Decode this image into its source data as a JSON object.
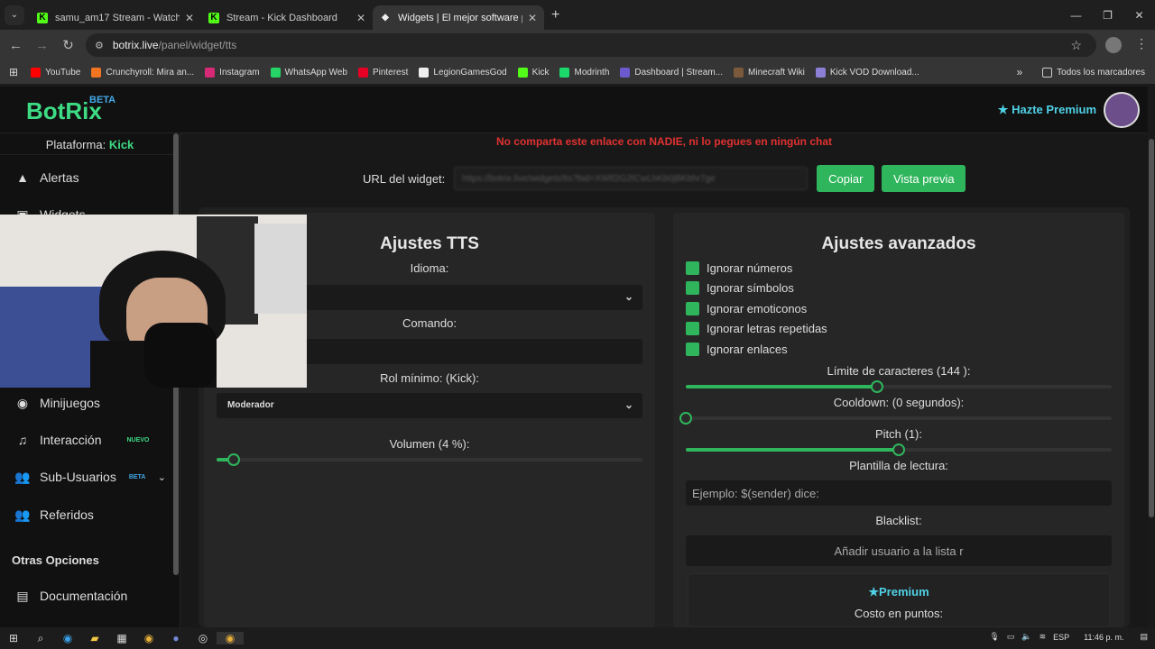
{
  "browser": {
    "tabs": [
      {
        "title": "samu_am17 Stream - Watch Live",
        "active": false,
        "icon": "kick-icon"
      },
      {
        "title": "Stream - Kick Dashboard",
        "active": false,
        "icon": "kick-icon"
      },
      {
        "title": "Widgets | El mejor software para",
        "active": true,
        "icon": "botrix-icon"
      }
    ],
    "url_host": "botrix.live",
    "url_path": "/panel/widget/tts",
    "bookmarks": [
      "YouTube",
      "Crunchyroll: Mira an...",
      "Instagram",
      "WhatsApp Web",
      "Pinterest",
      "LegionGamesGod",
      "Kick",
      "Modrinth",
      "Dashboard | Stream...",
      "Minecraft Wiki",
      "Kick VOD Download..."
    ],
    "bookmark_colors": [
      "#ff0000",
      "#f47521",
      "#d62976",
      "#25d366",
      "#e60023",
      "#eeeeee",
      "#53fc18",
      "#1bd96a",
      "#6a5acd",
      "#7a5a3a",
      "#8b7fd6"
    ],
    "all_bookmarks": "Todos los marcadores"
  },
  "header": {
    "logo": "BotRix",
    "logo_badge": "BETA",
    "premium_link": "Hazte Premium"
  },
  "sidebar": {
    "platform_label": "Plataforma:",
    "platform_value": "Kick",
    "items": [
      {
        "label": "Alertas"
      },
      {
        "label": "Widgets"
      },
      {
        "label": "Minijuegos"
      },
      {
        "label": "Interacción",
        "badge": "NUEVO"
      },
      {
        "label": "Sub-Usuarios",
        "badge": "BETA"
      },
      {
        "label": "Referidos"
      }
    ],
    "section": "Otras Opciones",
    "doc_label": "Documentación"
  },
  "widget": {
    "warning": "No comparta este enlace con NADIE, ni lo pegues en ningún chat",
    "url_label": "URL del widget:",
    "url_value": "https://botrix.live/widgets/tts?bid=XWtf2G2tCwLhKb0jBKbhr7ge",
    "copy_button": "Copiar",
    "preview_button": "Vista previa"
  },
  "tts": {
    "title": "Ajustes TTS",
    "language_label": "Idioma:",
    "command_label": "Comando:",
    "role_label": "Rol mínimo: (Kick):",
    "role_value": "Moderador",
    "volume_label": "Volumen (4 %):",
    "volume": 4
  },
  "advanced": {
    "title": "Ajustes avanzados",
    "checkboxes": [
      "Ignorar números",
      "Ignorar símbolos",
      "Ignorar emoticonos",
      "Ignorar letras repetidas",
      "Ignorar enlaces"
    ],
    "char_limit_label": "Límite de caracteres (144 ):",
    "char_limit": 144,
    "char_limit_fraction": 0.45,
    "cooldown_label": "Cooldown: (0 segundos):",
    "cooldown_fraction": 0,
    "pitch_label": "Pitch (1):",
    "pitch_fraction": 0.5,
    "template_label": "Plantilla de lectura:",
    "template_placeholder": "Ejemplo: $(sender) dice:",
    "blacklist_label": "Blacklist:",
    "blacklist_placeholder": "Añadir usuario a la lista r",
    "premium_title": "Premium",
    "cost_label": "Costo en puntos:"
  },
  "taskbar": {
    "lang": "ESP",
    "time": "11:46 p. m."
  },
  "colors": {
    "accent_green": "#2fb55c",
    "logo_green": "#3ddc84",
    "warning_red": "#e03131",
    "premium_cyan": "#4fd1e6"
  }
}
